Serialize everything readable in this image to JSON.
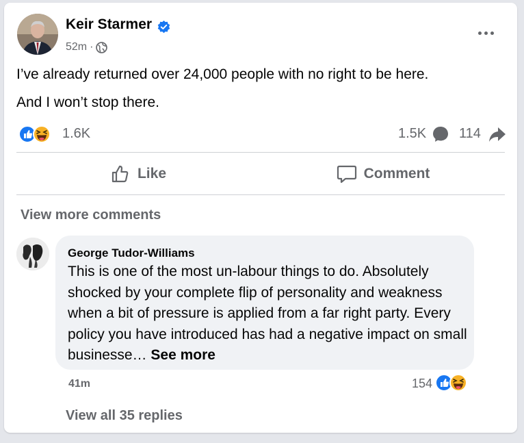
{
  "post": {
    "author": "Keir Starmer",
    "time": "52m",
    "separator": "·",
    "lines": [
      "I’ve already returned over 24,000 people with no right to be here.",
      "And I won’t stop there."
    ],
    "reaction_count": "1.6K",
    "comment_count": "1.5K",
    "share_count": "114"
  },
  "actions": {
    "like_label": "Like",
    "comment_label": "Comment"
  },
  "view_more_comments": "View more comments",
  "comment": {
    "author": "George Tudor-Williams",
    "text": "This is one of the most un-labour things to do. Absolutely shocked by your complete flip of personality and weakness when a bit of pressure is applied from a far right party. Every policy you have introduced has had a negative impact on small businesse…",
    "see_more": "See more",
    "time": "41m",
    "reaction_count": "154",
    "view_replies": "View all 35 replies"
  },
  "colors": {
    "brand_blue": "#1877f2",
    "secondary_text": "#65676b",
    "haha_yellow": "#f7b125"
  },
  "icons": [
    "verified-badge-icon",
    "globe-icon",
    "more-options-icon",
    "like-reaction-icon",
    "haha-reaction-icon",
    "comment-bubble-icon",
    "share-arrow-icon",
    "thumbs-up-icon",
    "comment-icon"
  ]
}
